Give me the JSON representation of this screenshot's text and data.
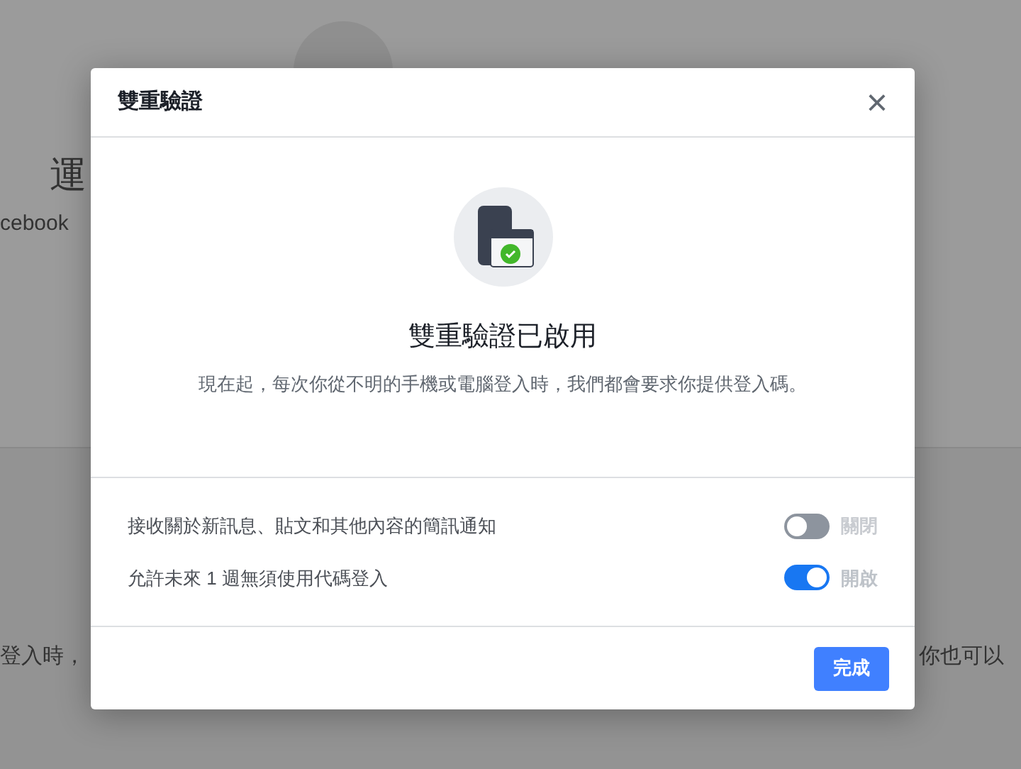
{
  "background": {
    "heading": "運",
    "line_1": "cebook",
    "line_2": "登入時，",
    "line_3": "你也可以"
  },
  "dialog": {
    "title": "雙重驗證",
    "close": "×",
    "status_title": "雙重驗證已啟用",
    "status_text": "現在起，每次你從不明的手機或電腦登入時，我們都會要求你提供登入碼。",
    "settings": [
      {
        "label": "接收關於新訊息、貼文和其他內容的簡訊通知",
        "on": false,
        "state_text": "關閉"
      },
      {
        "label": "允許未來 1 週無須使用代碼登入",
        "on": true,
        "state_text": "開啟"
      }
    ],
    "done_button": "完成"
  }
}
